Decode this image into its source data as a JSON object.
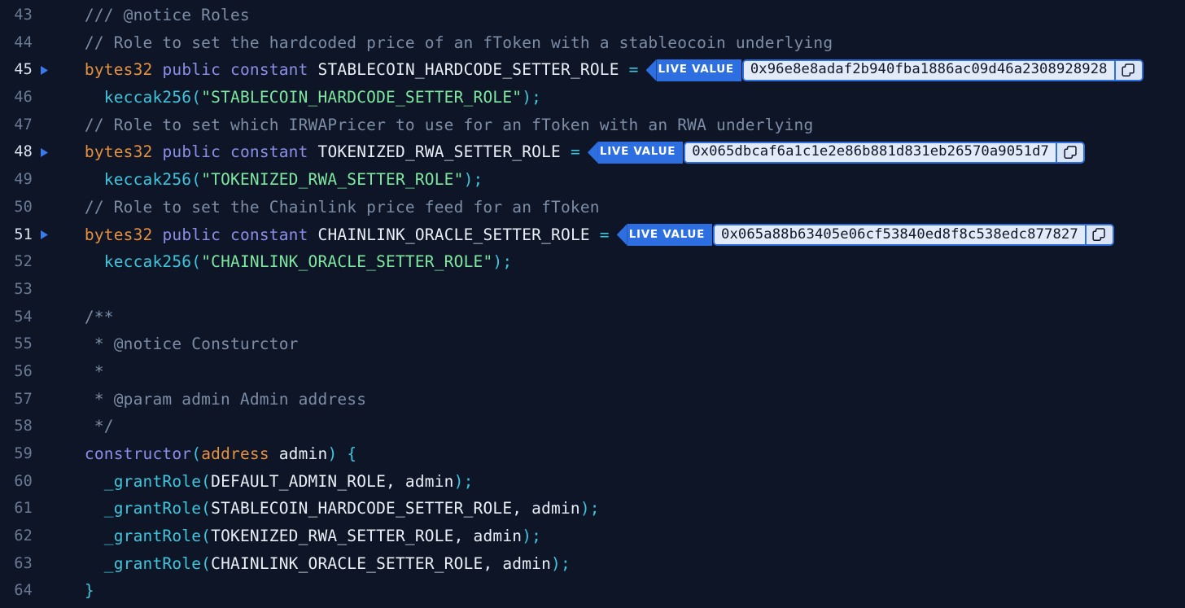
{
  "editor": {
    "theme_background": "#0d1526",
    "gutter_color": "#6b7a94",
    "accent_color": "#2d6fe0",
    "copy_icon": "copy-icon",
    "marker_icon": "play-triangle-icon",
    "live_value_label": "LIVE VALUE"
  },
  "lines": [
    {
      "num": "43",
      "marker": false,
      "indent": 1,
      "tokens": [
        {
          "t": "cm",
          "v": "/// @notice Roles"
        }
      ]
    },
    {
      "num": "44",
      "marker": false,
      "indent": 1,
      "tokens": [
        {
          "t": "cm",
          "v": "// Role to set the hardcoded price of an fToken with a stableocoin underlying"
        }
      ]
    },
    {
      "num": "45",
      "marker": true,
      "indent": 1,
      "tokens": [
        {
          "t": "ty",
          "v": "bytes32"
        },
        {
          "t": "sp",
          "v": " "
        },
        {
          "t": "kw",
          "v": "public constant"
        },
        {
          "t": "sp",
          "v": " "
        },
        {
          "t": "id",
          "v": "STABLECOIN_HARDCODE_SETTER_ROLE"
        },
        {
          "t": "sp",
          "v": " "
        },
        {
          "t": "op",
          "v": "="
        }
      ],
      "badge": {
        "label": "LIVE VALUE",
        "value": "0x96e8e8adaf2b940fba1886ac09d46a2308928928"
      }
    },
    {
      "num": "46",
      "marker": false,
      "indent": 2,
      "tokens": [
        {
          "t": "fn",
          "v": "keccak256"
        },
        {
          "t": "pn",
          "v": "("
        },
        {
          "t": "str",
          "v": "\"STABLECOIN_HARDCODE_SETTER_ROLE\""
        },
        {
          "t": "pn",
          "v": ");"
        }
      ]
    },
    {
      "num": "47",
      "marker": false,
      "indent": 1,
      "tokens": [
        {
          "t": "cm",
          "v": "// Role to set which IRWAPricer to use for an fToken with an RWA underlying"
        }
      ]
    },
    {
      "num": "48",
      "marker": true,
      "indent": 1,
      "tokens": [
        {
          "t": "ty",
          "v": "bytes32"
        },
        {
          "t": "sp",
          "v": " "
        },
        {
          "t": "kw",
          "v": "public constant"
        },
        {
          "t": "sp",
          "v": " "
        },
        {
          "t": "id",
          "v": "TOKENIZED_RWA_SETTER_ROLE"
        },
        {
          "t": "sp",
          "v": " "
        },
        {
          "t": "op",
          "v": "="
        }
      ],
      "badge": {
        "label": "LIVE VALUE",
        "value": "0x065dbcaf6a1c1e2e86b881d831eb26570a9051d7"
      }
    },
    {
      "num": "49",
      "marker": false,
      "indent": 2,
      "tokens": [
        {
          "t": "fn",
          "v": "keccak256"
        },
        {
          "t": "pn",
          "v": "("
        },
        {
          "t": "str",
          "v": "\"TOKENIZED_RWA_SETTER_ROLE\""
        },
        {
          "t": "pn",
          "v": ");"
        }
      ]
    },
    {
      "num": "50",
      "marker": false,
      "indent": 1,
      "tokens": [
        {
          "t": "cm",
          "v": "// Role to set the Chainlink price feed for an fToken"
        }
      ]
    },
    {
      "num": "51",
      "marker": true,
      "indent": 1,
      "tokens": [
        {
          "t": "ty",
          "v": "bytes32"
        },
        {
          "t": "sp",
          "v": " "
        },
        {
          "t": "kw",
          "v": "public constant"
        },
        {
          "t": "sp",
          "v": " "
        },
        {
          "t": "id",
          "v": "CHAINLINK_ORACLE_SETTER_ROLE"
        },
        {
          "t": "sp",
          "v": " "
        },
        {
          "t": "op",
          "v": "="
        }
      ],
      "badge": {
        "label": "LIVE VALUE",
        "value": "0x065a88b63405e06cf53840ed8f8c538edc877827"
      }
    },
    {
      "num": "52",
      "marker": false,
      "indent": 2,
      "tokens": [
        {
          "t": "fn",
          "v": "keccak256"
        },
        {
          "t": "pn",
          "v": "("
        },
        {
          "t": "str",
          "v": "\"CHAINLINK_ORACLE_SETTER_ROLE\""
        },
        {
          "t": "pn",
          "v": ");"
        }
      ]
    },
    {
      "num": "53",
      "marker": false,
      "indent": 0,
      "tokens": []
    },
    {
      "num": "54",
      "marker": false,
      "indent": 1,
      "tokens": [
        {
          "t": "cm",
          "v": "/**"
        }
      ]
    },
    {
      "num": "55",
      "marker": false,
      "indent": 1,
      "tokens": [
        {
          "t": "cm",
          "v": " * @notice Consturctor"
        }
      ]
    },
    {
      "num": "56",
      "marker": false,
      "indent": 1,
      "tokens": [
        {
          "t": "cm",
          "v": " *"
        }
      ]
    },
    {
      "num": "57",
      "marker": false,
      "indent": 1,
      "tokens": [
        {
          "t": "cm",
          "v": " * @param admin Admin address"
        }
      ]
    },
    {
      "num": "58",
      "marker": false,
      "indent": 1,
      "tokens": [
        {
          "t": "cm",
          "v": " */"
        }
      ]
    },
    {
      "num": "59",
      "marker": false,
      "indent": 1,
      "tokens": [
        {
          "t": "kw",
          "v": "constructor"
        },
        {
          "t": "pn",
          "v": "("
        },
        {
          "t": "ty",
          "v": "address"
        },
        {
          "t": "sp",
          "v": " "
        },
        {
          "t": "id",
          "v": "admin"
        },
        {
          "t": "pn",
          "v": ")"
        },
        {
          "t": "sp",
          "v": " "
        },
        {
          "t": "br",
          "v": "{"
        }
      ]
    },
    {
      "num": "60",
      "marker": false,
      "indent": 2,
      "tokens": [
        {
          "t": "fn",
          "v": "_grantRole"
        },
        {
          "t": "pn",
          "v": "("
        },
        {
          "t": "id",
          "v": "DEFAULT_ADMIN_ROLE, admin"
        },
        {
          "t": "pn",
          "v": ");"
        }
      ]
    },
    {
      "num": "61",
      "marker": false,
      "indent": 2,
      "tokens": [
        {
          "t": "fn",
          "v": "_grantRole"
        },
        {
          "t": "pn",
          "v": "("
        },
        {
          "t": "id",
          "v": "STABLECOIN_HARDCODE_SETTER_ROLE, admin"
        },
        {
          "t": "pn",
          "v": ");"
        }
      ]
    },
    {
      "num": "62",
      "marker": false,
      "indent": 2,
      "tokens": [
        {
          "t": "fn",
          "v": "_grantRole"
        },
        {
          "t": "pn",
          "v": "("
        },
        {
          "t": "id",
          "v": "TOKENIZED_RWA_SETTER_ROLE, admin"
        },
        {
          "t": "pn",
          "v": ");"
        }
      ]
    },
    {
      "num": "63",
      "marker": false,
      "indent": 2,
      "tokens": [
        {
          "t": "fn",
          "v": "_grantRole"
        },
        {
          "t": "pn",
          "v": "("
        },
        {
          "t": "id",
          "v": "CHAINLINK_ORACLE_SETTER_ROLE, admin"
        },
        {
          "t": "pn",
          "v": ");"
        }
      ]
    },
    {
      "num": "64",
      "marker": false,
      "indent": 1,
      "tokens": [
        {
          "t": "br",
          "v": "}"
        }
      ]
    }
  ]
}
